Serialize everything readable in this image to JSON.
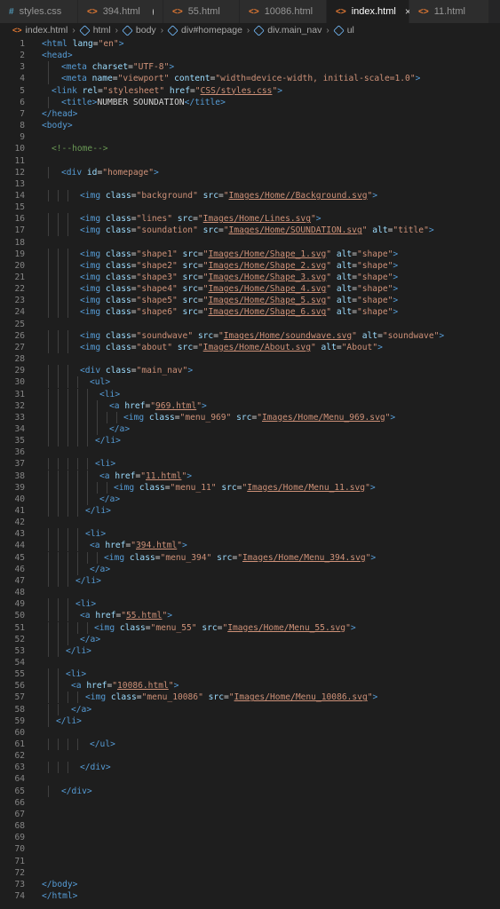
{
  "tabs": [
    {
      "label": "styles.css",
      "icon": "css-file-icon",
      "active": false,
      "dirty": false
    },
    {
      "label": "394.html",
      "icon": "html-file-icon",
      "active": false,
      "dirty": true
    },
    {
      "label": "55.html",
      "icon": "html-file-icon",
      "active": false,
      "dirty": false
    },
    {
      "label": "10086.html",
      "icon": "html-file-icon",
      "active": false,
      "dirty": false
    },
    {
      "label": "index.html",
      "icon": "html-file-icon",
      "active": true,
      "dirty": false
    },
    {
      "label": "11.html",
      "icon": "html-file-icon",
      "active": false,
      "dirty": false
    }
  ],
  "breadcrumb": [
    "index.html",
    "html",
    "body",
    "div#homepage",
    "div.main_nav",
    "ul"
  ],
  "code_lines": [
    {
      "n": "1",
      "i": 0,
      "t": "<html lang=\"en\">"
    },
    {
      "n": "2",
      "i": 0,
      "t": "<head>"
    },
    {
      "n": "3",
      "i": 22,
      "t": "<meta charset=\"UTF-8\">"
    },
    {
      "n": "4",
      "i": 22,
      "t": "<meta name=\"viewport\" content=\"width=device-width, initial-scale=1.0\">"
    },
    {
      "n": "5",
      "i": 11,
      "t": "<link rel=\"stylesheet\" href=\"CSS/styles.css\">"
    },
    {
      "n": "6",
      "i": 22,
      "t": "<title>NUMBER SOUNDATION</title>"
    },
    {
      "n": "7",
      "i": 0,
      "t": "</head>"
    },
    {
      "n": "8",
      "i": 0,
      "t": "<body>"
    },
    {
      "n": "9",
      "i": 0,
      "t": ""
    },
    {
      "n": "10",
      "i": 11,
      "t": "<!--home-->"
    },
    {
      "n": "11",
      "i": 0,
      "t": ""
    },
    {
      "n": "12",
      "i": 22,
      "t": "<div id=\"homepage\">"
    },
    {
      "n": "13",
      "i": 0,
      "t": ""
    },
    {
      "n": "14",
      "i": 43,
      "t": "<img class=\"background\" src=\"Images/Home//Background.svg\">"
    },
    {
      "n": "15",
      "i": 0,
      "t": ""
    },
    {
      "n": "16",
      "i": 43,
      "t": "<img class=\"lines\" src=\"Images/Home/Lines.svg\">"
    },
    {
      "n": "17",
      "i": 43,
      "t": "<img class=\"soundation\" src=\"Images/Home/SOUNDATION.svg\" alt=\"title\">"
    },
    {
      "n": "18",
      "i": 0,
      "t": ""
    },
    {
      "n": "19",
      "i": 43,
      "t": "<img class=\"shape1\" src=\"Images/Home/Shape_1.svg\" alt=\"shape\">"
    },
    {
      "n": "20",
      "i": 43,
      "t": "<img class=\"shape2\" src=\"Images/Home/Shape_2.svg\" alt=\"shape\">"
    },
    {
      "n": "21",
      "i": 43,
      "t": "<img class=\"shape3\" src=\"Images/Home/Shape_3.svg\" alt=\"shape\">"
    },
    {
      "n": "22",
      "i": 43,
      "t": "<img class=\"shape4\" src=\"Images/Home/Shape_4.svg\" alt=\"shape\">"
    },
    {
      "n": "23",
      "i": 43,
      "t": "<img class=\"shape5\" src=\"Images/Home/Shape_5.svg\" alt=\"shape\">"
    },
    {
      "n": "24",
      "i": 43,
      "t": "<img class=\"shape6\" src=\"Images/Home/Shape_6.svg\" alt=\"shape\">"
    },
    {
      "n": "25",
      "i": 0,
      "t": ""
    },
    {
      "n": "26",
      "i": 43,
      "t": "<img class=\"soundwave\" src=\"Images/Home/soundwave.svg\" alt=\"soundwave\">"
    },
    {
      "n": "27",
      "i": 43,
      "t": "<img class=\"about\" src=\"Images/Home/About.svg\" alt=\"About\">"
    },
    {
      "n": "28",
      "i": 0,
      "t": ""
    },
    {
      "n": "29",
      "i": 43,
      "t": "<div class=\"main_nav\">"
    },
    {
      "n": "30",
      "i": 54,
      "t": "<ul>"
    },
    {
      "n": "31",
      "i": 65,
      "t": "<li>"
    },
    {
      "n": "32",
      "i": 76,
      "t": "<a href=\"969.html\">"
    },
    {
      "n": "33",
      "i": 92,
      "t": "<img class=\"menu_969\" src=\"Images/Home/Menu_969.svg\">"
    },
    {
      "n": "34",
      "i": 76,
      "t": "</a>"
    },
    {
      "n": "35",
      "i": 60,
      "t": "</li>"
    },
    {
      "n": "36",
      "i": 0,
      "t": ""
    },
    {
      "n": "37",
      "i": 60,
      "t": "<li>"
    },
    {
      "n": "38",
      "i": 65,
      "t": "<a href=\"11.html\">"
    },
    {
      "n": "39",
      "i": 81,
      "t": "<img class=\"menu_11\" src=\"Images/Home/Menu_11.svg\">"
    },
    {
      "n": "40",
      "i": 65,
      "t": "</a>"
    },
    {
      "n": "41",
      "i": 49,
      "t": "</li>"
    },
    {
      "n": "42",
      "i": 0,
      "t": ""
    },
    {
      "n": "43",
      "i": 49,
      "t": "<li>"
    },
    {
      "n": "44",
      "i": 54,
      "t": "<a href=\"394.html\">"
    },
    {
      "n": "45",
      "i": 70,
      "t": "<img class=\"menu_394\" src=\"Images/Home/Menu_394.svg\">"
    },
    {
      "n": "46",
      "i": 54,
      "t": "</a>"
    },
    {
      "n": "47",
      "i": 38,
      "t": "</li>"
    },
    {
      "n": "48",
      "i": 0,
      "t": ""
    },
    {
      "n": "49",
      "i": 38,
      "t": "<li>"
    },
    {
      "n": "50",
      "i": 43,
      "t": "<a href=\"55.html\">"
    },
    {
      "n": "51",
      "i": 59,
      "t": "<img class=\"menu_55\" src=\"Images/Home/Menu_55.svg\">"
    },
    {
      "n": "52",
      "i": 43,
      "t": "</a>"
    },
    {
      "n": "53",
      "i": 27,
      "t": "</li>"
    },
    {
      "n": "54",
      "i": 0,
      "t": ""
    },
    {
      "n": "55",
      "i": 27,
      "t": "<li>"
    },
    {
      "n": "56",
      "i": 33,
      "t": "<a href=\"10086.html\">"
    },
    {
      "n": "57",
      "i": 49,
      "t": "<img class=\"menu_10086\" src=\"Images/Home/Menu_10086.svg\">"
    },
    {
      "n": "58",
      "i": 33,
      "t": "</a>"
    },
    {
      "n": "59",
      "i": 16,
      "t": "</li>"
    },
    {
      "n": "60",
      "i": 0,
      "t": ""
    },
    {
      "n": "61",
      "i": 54,
      "t": "</ul>"
    },
    {
      "n": "62",
      "i": 0,
      "t": ""
    },
    {
      "n": "63",
      "i": 43,
      "t": "</div>"
    },
    {
      "n": "64",
      "i": 0,
      "t": ""
    },
    {
      "n": "65",
      "i": 22,
      "t": "</div>"
    },
    {
      "n": "66",
      "i": 0,
      "t": ""
    },
    {
      "n": "67",
      "i": 0,
      "t": ""
    },
    {
      "n": "68",
      "i": 0,
      "t": ""
    },
    {
      "n": "69",
      "i": 0,
      "t": ""
    },
    {
      "n": "70",
      "i": 0,
      "t": ""
    },
    {
      "n": "71",
      "i": 0,
      "t": ""
    },
    {
      "n": "72",
      "i": 0,
      "t": ""
    },
    {
      "n": "73",
      "i": 0,
      "t": "</body>"
    },
    {
      "n": "74",
      "i": 0,
      "t": "</html>"
    }
  ]
}
